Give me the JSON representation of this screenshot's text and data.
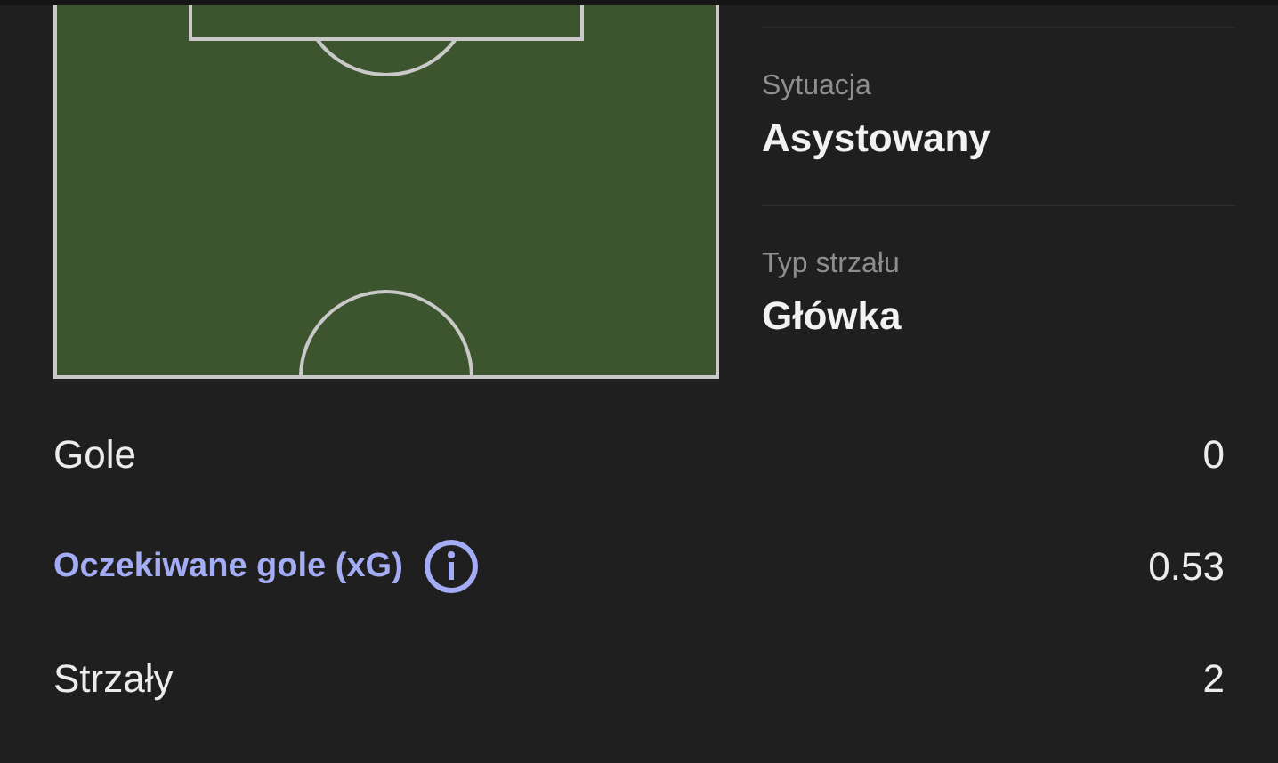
{
  "details": [
    {
      "label": "Sytuacja",
      "value": "Asystowany"
    },
    {
      "label": "Typ strzału",
      "value": "Główka"
    }
  ],
  "stats": [
    {
      "kind": "plain",
      "label": "Gole",
      "value": "0"
    },
    {
      "kind": "info",
      "label": "Oczekiwane gole (xG)",
      "value": "0.53"
    },
    {
      "kind": "plain",
      "label": "Strzały",
      "value": "2"
    }
  ]
}
